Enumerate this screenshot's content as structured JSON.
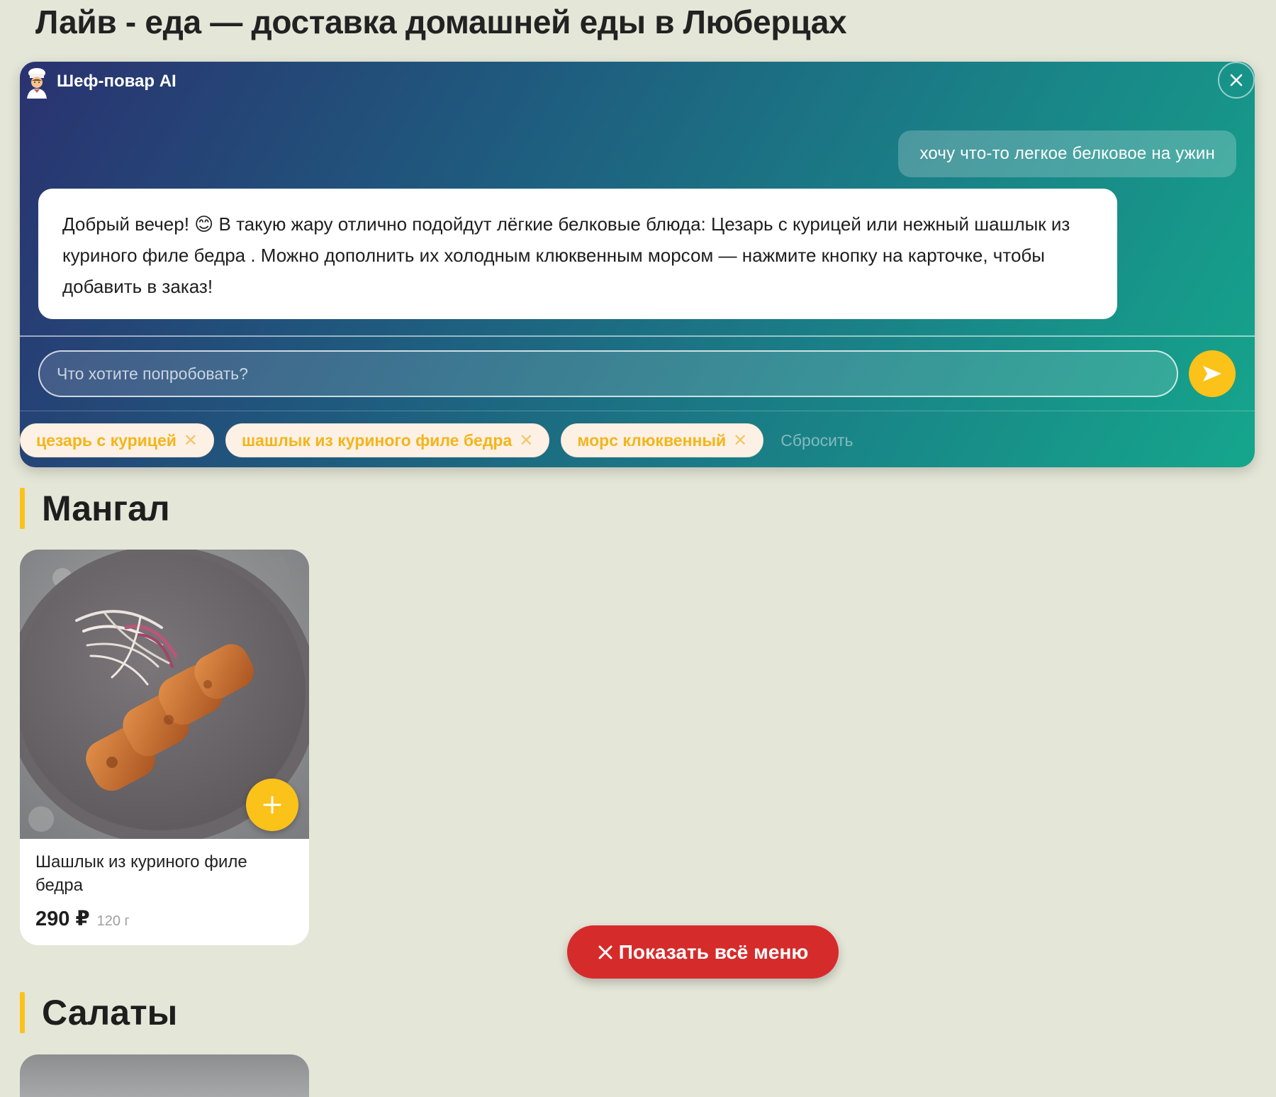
{
  "page": {
    "title": "Лайв - еда — доставка домашней еды в Люберцах"
  },
  "chat": {
    "title": "Шеф-повар AI",
    "icons": {
      "chef": "chef-icon",
      "close": "close-icon",
      "send": "send-arrow-icon"
    },
    "user_message": "хочу что-то легкое белковое на ужин",
    "bot_message": "Добрый вечер! 😊 В такую жару отлично подойдут лёгкие белковые блюда: Цезарь с курицей или нежный шашлык из куриного филе бедра . Можно дополнить их холодным клюквенным морсом — нажмите кнопку на карточке, чтобы добавить в заказ!",
    "input_placeholder": "Что хотите попробовать?",
    "input_value": "",
    "chips": [
      {
        "label": "цезарь с курицей"
      },
      {
        "label": "шашлык из куриного филе бедра"
      },
      {
        "label": "морс клюквенный"
      }
    ],
    "reset_label": "Сбросить",
    "colors": {
      "accent": "#fbc21a",
      "chip_text": "#f3b51a",
      "gradient_start": "#2a3270",
      "gradient_end": "#15a68c"
    }
  },
  "sections": [
    {
      "title": "Мангал",
      "items": [
        {
          "name": "Шашлык из куриного филе бедра",
          "price": "290 ₽",
          "weight": "120 г"
        }
      ]
    },
    {
      "title": "Салаты"
    }
  ],
  "floating_button": {
    "label": "Показать всё меню",
    "icon": "close-icon",
    "color": "#d62b2b"
  }
}
